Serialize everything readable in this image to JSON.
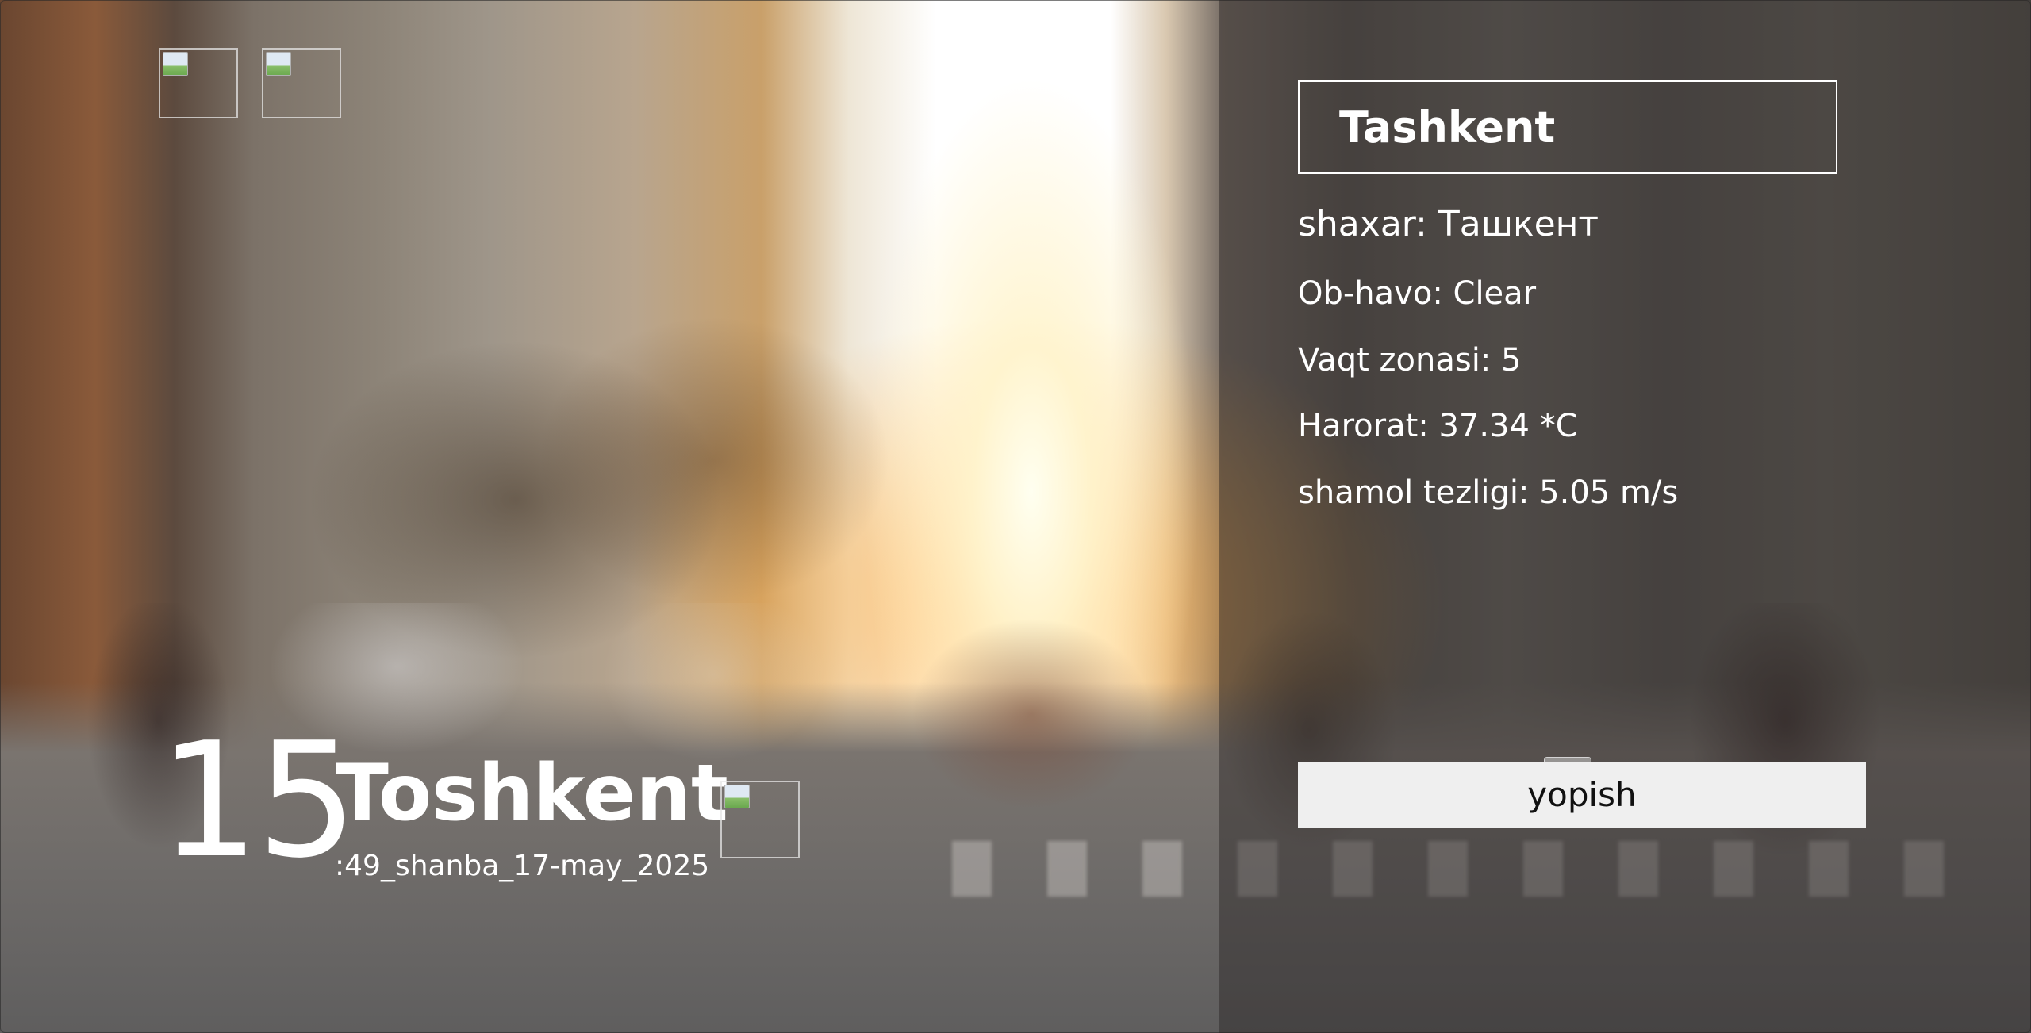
{
  "weather_card": {
    "temperature": "15",
    "city": "Toshkent",
    "datetime": ":49_shanba_17-may_2025"
  },
  "search": {
    "value": "Tashkent"
  },
  "details": {
    "city_line": "shaxar: Ташкент",
    "weather_line": "Ob-havo: Clear",
    "timezone_line": "Vaqt zonasi: 5",
    "temperature_line": "Harorat: 37.34 *C",
    "wind_line": "shamol tezligi: 5.05 m/s"
  },
  "panel": {
    "close_label": "yopish"
  },
  "icons": {
    "top_left_1": "broken-image-icon",
    "top_left_2": "broken-image-icon",
    "weather": "broken-image-icon"
  },
  "colors": {
    "text": "#ffffff",
    "panel_overlay": "#23201e",
    "button_bg": "#efefef",
    "button_text": "#111111"
  }
}
